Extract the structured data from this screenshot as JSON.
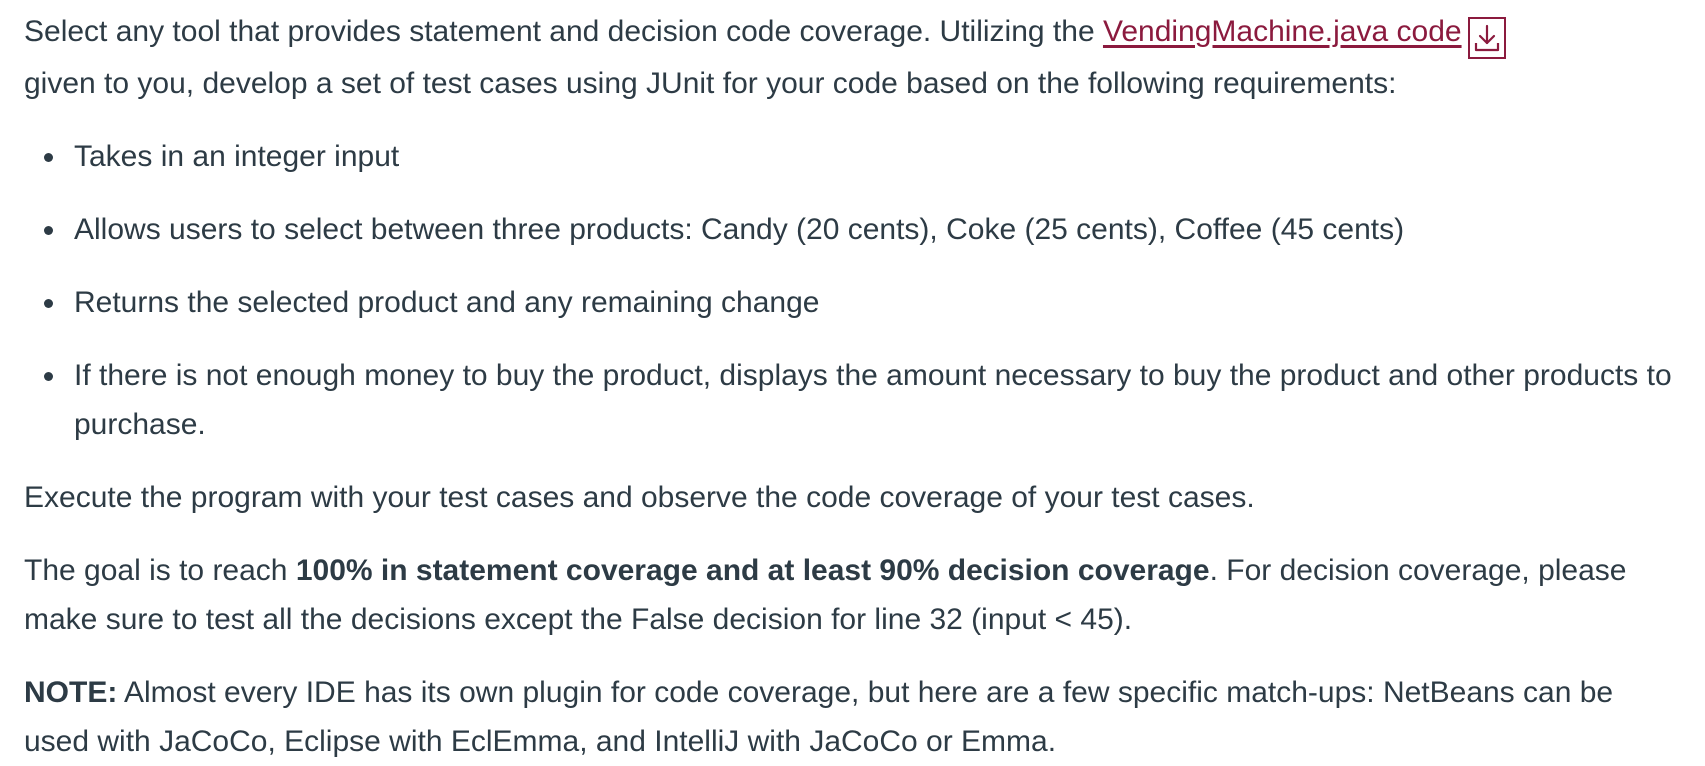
{
  "intro": {
    "text_before_link": "Select any tool that provides statement and decision code coverage. Utilizing the ",
    "link_text": "VendingMachine.java code",
    "text_after_link": " given to you, develop a set of test cases using JUnit for your code based on the following requirements:",
    "download_icon": "download-arrow-icon",
    "link_color": "#8b1a3e"
  },
  "requirements": [
    "Takes in an integer input",
    "Allows users to select between three products: Candy (20 cents), Coke (25 cents), Coffee (45 cents)",
    "Returns the selected product and any remaining change",
    "If there is not enough money to buy the product, displays the amount necessary to buy the product and other products to purchase."
  ],
  "execute_text": "Execute the program with your test cases and observe the code coverage of your test cases.",
  "goal": {
    "prefix": "The goal is to reach ",
    "bold": "100% in statement coverage and at least 90% decision coverage",
    "suffix": ". For decision coverage, please make sure to test all the decisions except the False decision for line 32 (input < 45)."
  },
  "note": {
    "label": "NOTE:",
    "text": " Almost every IDE has its own plugin for code coverage, but here are a few specific match-ups: NetBeans can be used with JaCoCo, Eclipse with EclEmma, and IntelliJ with JaCoCo or Emma."
  },
  "colors": {
    "text": "#2d3b45",
    "accent": "#8b1a3e",
    "background": "#ffffff"
  }
}
